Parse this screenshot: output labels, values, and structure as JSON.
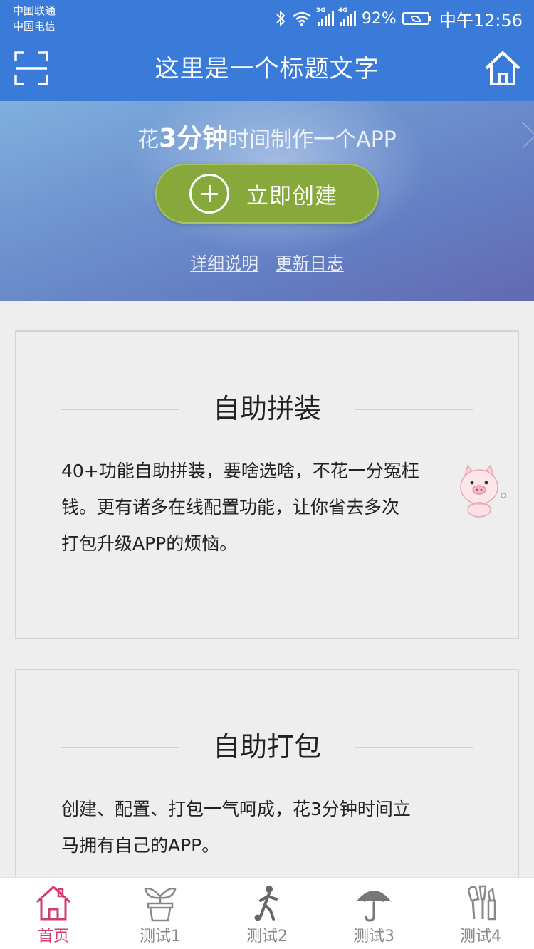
{
  "status_bar": {
    "carrier_1": "中国联通",
    "carrier_2": "中国电信",
    "network_1": "3G",
    "network_2": "4G",
    "battery": "92%",
    "time": "中午12:56"
  },
  "nav": {
    "title": "这里是一个标题文字",
    "left_icon": "scan-icon",
    "right_icon": "home-icon"
  },
  "hero": {
    "tagline_pre": "花",
    "tagline_emph": "3分钟",
    "tagline_post": "时间制作一个APP",
    "create_button": "立即创建",
    "link_details": "详细说明",
    "link_changelog": "更新日志"
  },
  "cards": [
    {
      "title": "自助拼装",
      "lines": [
        "40+功能自助拼装，要啥选啥，不花一分冤枉",
        "钱。更有诸多在线配置功能，让你省去多次",
        "打包升级APP的烦恼。"
      ]
    },
    {
      "title": "自助打包",
      "lines": [
        "创建、配置、打包一气呵成，花3分钟时间立",
        "马拥有自己的APP。"
      ]
    }
  ],
  "tabs": [
    {
      "label": "首页",
      "icon": "house-icon",
      "active": true
    },
    {
      "label": "测试1",
      "icon": "plant-pot-icon",
      "active": false
    },
    {
      "label": "测试2",
      "icon": "soccer-player-icon",
      "active": false
    },
    {
      "label": "测试3",
      "icon": "umbrella-icon",
      "active": false
    },
    {
      "label": "测试4",
      "icon": "makeup-brushes-icon",
      "active": false
    }
  ],
  "colors": {
    "primary": "#3a7ad8",
    "button_green": "#87a83a",
    "tab_active": "#d23b6f",
    "tab_inactive": "#888888",
    "background": "#eeeeee"
  }
}
